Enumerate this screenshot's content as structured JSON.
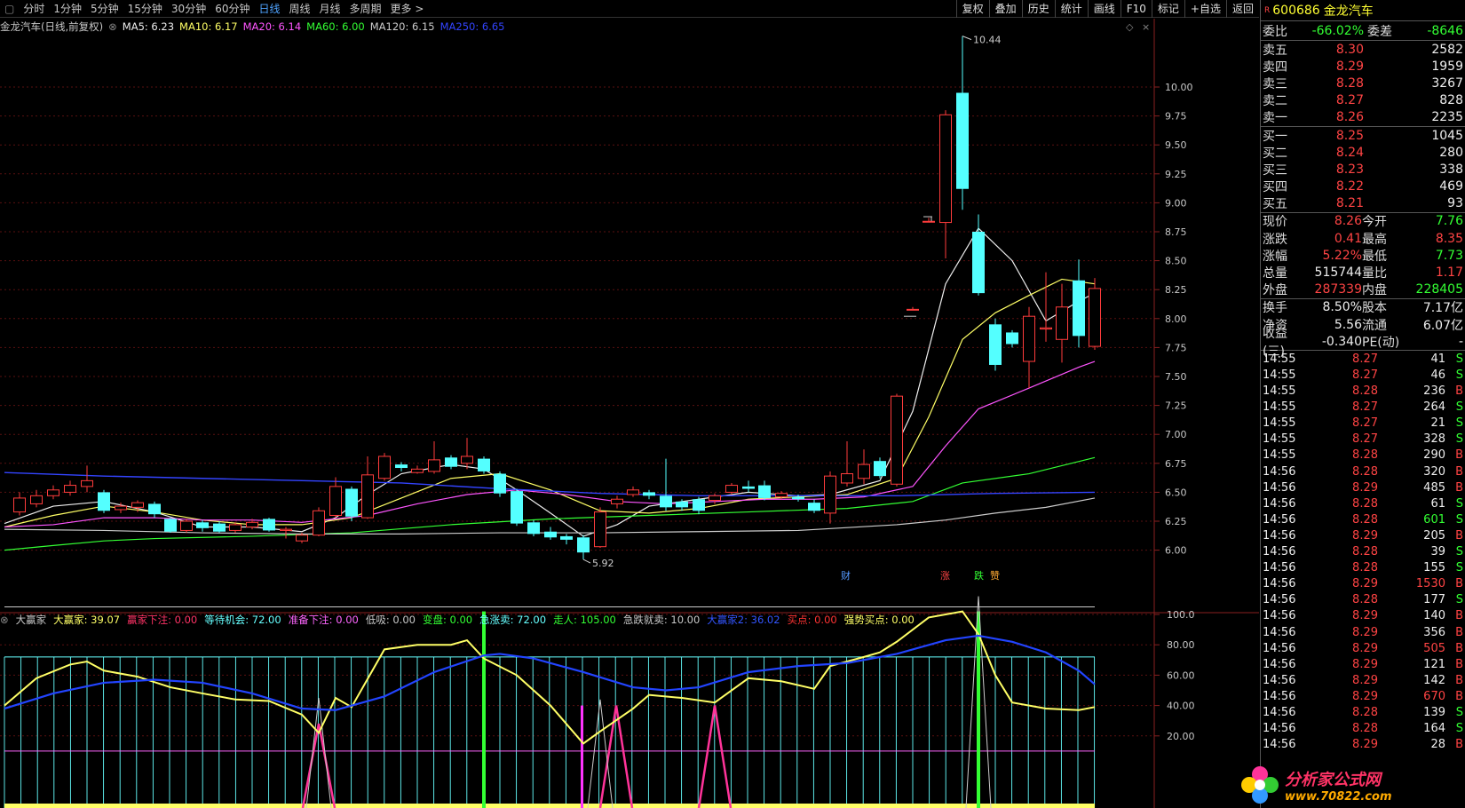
{
  "topbar": {
    "periods": [
      "分时",
      "1分钟",
      "5分钟",
      "15分钟",
      "30分钟",
      "60分钟",
      "日线",
      "周线",
      "月线",
      "多周期",
      "更多 >"
    ],
    "active_period": "日线",
    "tools": [
      "复权",
      "叠加",
      "历史",
      "统计",
      "画线",
      "F10",
      "标记",
      "+自选",
      "返回"
    ]
  },
  "main_legend": {
    "title": "金龙汽车(日线,前复权)",
    "ma5": "MA5: 6.23",
    "ma10": "MA10: 6.17",
    "ma20": "MA20: 6.14",
    "ma60": "MA60: 6.00",
    "ma120": "MA120: 6.15",
    "ma250": "MA250: 6.65"
  },
  "main_yaxis": [
    "10.00",
    "9.75",
    "9.50",
    "9.25",
    "9.00",
    "8.75",
    "8.50",
    "8.25",
    "8.00",
    "7.75",
    "7.50",
    "7.25",
    "7.00",
    "6.75",
    "6.50",
    "6.25",
    "6.00"
  ],
  "annotations": {
    "high": "10.44",
    "low": "5.92",
    "events": [
      "财",
      "涨",
      "跌",
      "赞"
    ]
  },
  "sub_legend": {
    "name": "大赢家",
    "items": [
      {
        "text": "大赢家: 39.07",
        "color": "#ffff66"
      },
      {
        "text": "赢家下注: 0.00",
        "color": "#ff3366"
      },
      {
        "text": "等待机会: 72.00",
        "color": "#66ffff"
      },
      {
        "text": "准备下注: 0.00",
        "color": "#ff66ff"
      },
      {
        "text": "低吸: 0.00",
        "color": "#c8c8c8"
      },
      {
        "text": "变盘: 0.00",
        "color": "#33ff33"
      },
      {
        "text": "急涨卖: 72.00",
        "color": "#66ffff"
      },
      {
        "text": "走人: 105.00",
        "color": "#33ff33"
      },
      {
        "text": "急跌就卖: 10.00",
        "color": "#c8c8c8"
      },
      {
        "text": "大赢家2: 36.02",
        "color": "#3355ff"
      },
      {
        "text": "买点: 0.00",
        "color": "#ff3333"
      },
      {
        "text": "强势买点: 0.00",
        "color": "#ffff66"
      }
    ]
  },
  "sub_yaxis": [
    "100.0",
    "80.00",
    "60.00",
    "40.00",
    "20.00"
  ],
  "panel": {
    "code": "600686",
    "name": "金龙汽车",
    "weibi_label": "委比",
    "weibi": "-66.02%",
    "weicha_label": "委差",
    "weicha": "-8646",
    "asks": [
      {
        "label": "卖五",
        "price": "8.30",
        "vol": "2582"
      },
      {
        "label": "卖四",
        "price": "8.29",
        "vol": "1959"
      },
      {
        "label": "卖三",
        "price": "8.28",
        "vol": "3267"
      },
      {
        "label": "卖二",
        "price": "8.27",
        "vol": "828"
      },
      {
        "label": "卖一",
        "price": "8.26",
        "vol": "2235"
      }
    ],
    "bids": [
      {
        "label": "买一",
        "price": "8.25",
        "vol": "1045"
      },
      {
        "label": "买二",
        "price": "8.24",
        "vol": "280"
      },
      {
        "label": "买三",
        "price": "8.23",
        "vol": "338"
      },
      {
        "label": "买四",
        "price": "8.22",
        "vol": "469"
      },
      {
        "label": "买五",
        "price": "8.21",
        "vol": "93"
      }
    ],
    "stats": [
      {
        "l1": "现价",
        "v1": "8.26",
        "c1": "red",
        "l2": "今开",
        "v2": "7.76",
        "c2": "green"
      },
      {
        "l1": "涨跌",
        "v1": "0.41",
        "c1": "red",
        "l2": "最高",
        "v2": "8.35",
        "c2": "red"
      },
      {
        "l1": "涨幅",
        "v1": "5.22%",
        "c1": "red",
        "l2": "最低",
        "v2": "7.73",
        "c2": "green"
      },
      {
        "l1": "总量",
        "v1": "515744",
        "c1": "white",
        "l2": "量比",
        "v2": "1.17",
        "c2": "red"
      },
      {
        "l1": "外盘",
        "v1": "287339",
        "c1": "red",
        "l2": "内盘",
        "v2": "228405",
        "c2": "green"
      }
    ],
    "stats2": [
      {
        "l1": "换手",
        "v1": "8.50%",
        "l2": "股本",
        "v2": "7.17亿"
      },
      {
        "l1": "净资",
        "v1": "5.56",
        "l2": "流通",
        "v2": "6.07亿"
      },
      {
        "l1": "收益(三)",
        "v1": "-0.340",
        "l2": "PE(动)",
        "v2": "-"
      }
    ],
    "ticks": [
      [
        "14:55",
        "8.27",
        "41",
        "S"
      ],
      [
        "14:55",
        "8.27",
        "46",
        "S"
      ],
      [
        "14:55",
        "8.28",
        "236",
        "B"
      ],
      [
        "14:55",
        "8.27",
        "264",
        "S"
      ],
      [
        "14:55",
        "8.27",
        "21",
        "S"
      ],
      [
        "14:55",
        "8.27",
        "328",
        "S"
      ],
      [
        "14:55",
        "8.28",
        "290",
        "B"
      ],
      [
        "14:56",
        "8.28",
        "320",
        "B"
      ],
      [
        "14:56",
        "8.29",
        "485",
        "B"
      ],
      [
        "14:56",
        "8.28",
        "61",
        "S"
      ],
      [
        "14:56",
        "8.28",
        "601",
        "S"
      ],
      [
        "14:56",
        "8.29",
        "205",
        "B"
      ],
      [
        "14:56",
        "8.28",
        "39",
        "S"
      ],
      [
        "14:56",
        "8.28",
        "155",
        "S"
      ],
      [
        "14:56",
        "8.29",
        "1530",
        "B"
      ],
      [
        "14:56",
        "8.28",
        "177",
        "S"
      ],
      [
        "14:56",
        "8.29",
        "140",
        "B"
      ],
      [
        "14:56",
        "8.29",
        "356",
        "B"
      ],
      [
        "14:56",
        "8.29",
        "505",
        "B"
      ],
      [
        "14:56",
        "8.29",
        "121",
        "B"
      ],
      [
        "14:56",
        "8.29",
        "142",
        "B"
      ],
      [
        "14:56",
        "8.29",
        "670",
        "B"
      ],
      [
        "14:56",
        "8.28",
        "139",
        "S"
      ],
      [
        "14:56",
        "8.28",
        "164",
        "S"
      ],
      [
        "14:56",
        "8.29",
        "28",
        "B"
      ]
    ]
  },
  "watermark": {
    "brand": "分析家公式网",
    "url": "www.70822.com"
  }
}
